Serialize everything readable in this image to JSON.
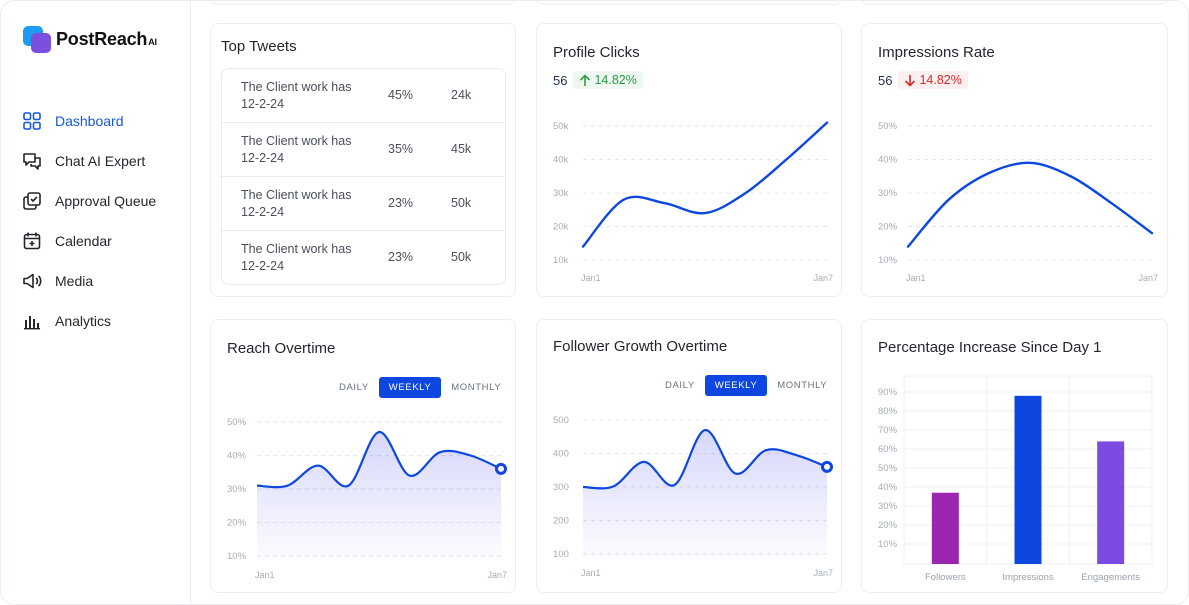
{
  "brand": {
    "name": "PostReach",
    "suffix": "AI"
  },
  "sidebar": {
    "items": [
      {
        "label": "Dashboard",
        "icon": "grid-icon",
        "active": true
      },
      {
        "label": "Chat AI Expert",
        "icon": "chat-bubbles-icon"
      },
      {
        "label": "Approval Queue",
        "icon": "stacked-check-icon"
      },
      {
        "label": "Calendar",
        "icon": "calendar-plus-icon"
      },
      {
        "label": "Media",
        "icon": "megaphone-icon"
      },
      {
        "label": "Analytics",
        "icon": "bar-chart-icon"
      }
    ]
  },
  "top_tweets": {
    "title": "Top Tweets",
    "rows": [
      {
        "text": "The Client work has 12-2-24",
        "percent": "45%",
        "count": "24k"
      },
      {
        "text": "The Client work has 12-2-24",
        "percent": "35%",
        "count": "45k"
      },
      {
        "text": "The Client work has 12-2-24",
        "percent": "23%",
        "count": "50k"
      },
      {
        "text": "The Client work has 12-2-24",
        "percent": "23%",
        "count": "50k"
      }
    ]
  },
  "profile_clicks": {
    "title": "Profile Clicks",
    "value": "56",
    "change": "14.82%",
    "trend": "up",
    "chart_data": {
      "type": "line",
      "x_labels": [
        "Jan1",
        "Jan7"
      ],
      "y_ticks": [
        "50k",
        "40k",
        "30k",
        "20k",
        "10k"
      ],
      "ylim": [
        10,
        50
      ],
      "x": [
        1,
        2,
        3,
        4,
        5,
        6,
        7
      ],
      "series": [
        {
          "values": [
            14,
            28,
            27,
            24,
            30,
            40,
            51
          ]
        }
      ],
      "color": "#0d47e0"
    }
  },
  "impressions_rate": {
    "title": "Impressions Rate",
    "value": "56",
    "change": "14.82%",
    "trend": "down",
    "chart_data": {
      "type": "line",
      "x_labels": [
        "Jan1",
        "Jan7"
      ],
      "y_ticks": [
        "50%",
        "40%",
        "30%",
        "20%",
        "10%"
      ],
      "ylim": [
        10,
        50
      ],
      "x": [
        1,
        2,
        3,
        4,
        5,
        6,
        7
      ],
      "series": [
        {
          "values": [
            14,
            28,
            36,
            39,
            35,
            27,
            18
          ]
        }
      ],
      "color": "#0d47e0"
    }
  },
  "reach_overtime": {
    "title": "Reach Overtime",
    "toggle": [
      "DAILY",
      "WEEKLY",
      "MONTHLY"
    ],
    "active": "WEEKLY",
    "chart_data": {
      "type": "area",
      "x_labels": [
        "Jan1",
        "Jan7"
      ],
      "y_ticks": [
        "50%",
        "40%",
        "30%",
        "20%",
        "10%"
      ],
      "ylim": [
        10,
        50
      ],
      "x": [
        0,
        1,
        2,
        3,
        4,
        5,
        6,
        7,
        8
      ],
      "series": [
        {
          "values": [
            31,
            31,
            37,
            31,
            47,
            34,
            41,
            40,
            36
          ]
        }
      ],
      "color": "#0d47e0"
    }
  },
  "follower_growth": {
    "title": "Follower Growth Overtime",
    "toggle": [
      "DAILY",
      "WEEKLY",
      "MONTHLY"
    ],
    "active": "WEEKLY",
    "chart_data": {
      "type": "area",
      "x_labels": [
        "Jan1",
        "Jan7"
      ],
      "y_ticks": [
        "500",
        "400",
        "300",
        "200",
        "100"
      ],
      "ylim": [
        100,
        500
      ],
      "x": [
        0,
        1,
        2,
        3,
        4,
        5,
        6,
        7,
        8
      ],
      "series": [
        {
          "values": [
            300,
            302,
            375,
            306,
            470,
            340,
            410,
            395,
            360
          ]
        }
      ],
      "color": "#0d47e0"
    }
  },
  "percentage_increase": {
    "title": "Percentage Increase Since Day 1",
    "chart_data": {
      "type": "bar",
      "categories": [
        "Followers",
        "Impressions",
        "Engagements"
      ],
      "values": [
        37,
        88,
        64
      ],
      "colors": [
        "#9b27b0",
        "#0d47e0",
        "#7c4ae0"
      ],
      "y_ticks": [
        "90%",
        "80%",
        "70%",
        "60%",
        "50%",
        "40%",
        "30%",
        "20%",
        "10%"
      ],
      "ylim": [
        0,
        90
      ]
    }
  }
}
